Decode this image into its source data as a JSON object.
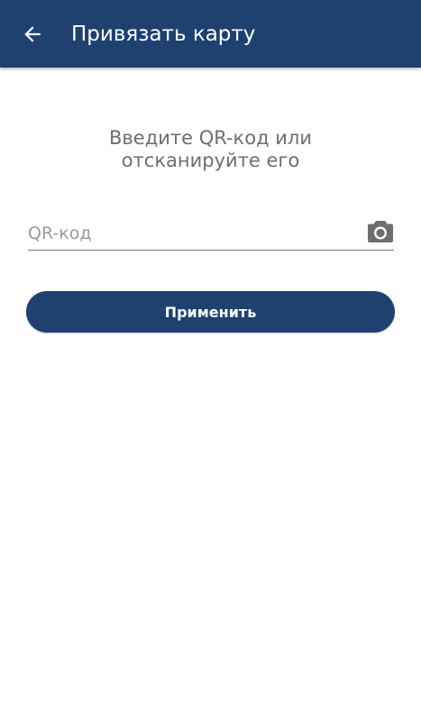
{
  "header": {
    "title": "Привязать карту",
    "back_icon": "arrow-left-icon"
  },
  "main": {
    "prompt_line1": "Введите QR-код или",
    "prompt_line2": "отсканируйте его",
    "qr_input": {
      "value": "",
      "placeholder": "QR-код",
      "scan_icon": "camera-icon"
    },
    "apply_label": "Применить"
  },
  "colors": {
    "primary": "#1f4170",
    "background": "#ffffff",
    "prompt_text": "#6e6e6e",
    "placeholder_text": "#9a9a9a",
    "camera_icon": "#6e6e6e"
  }
}
